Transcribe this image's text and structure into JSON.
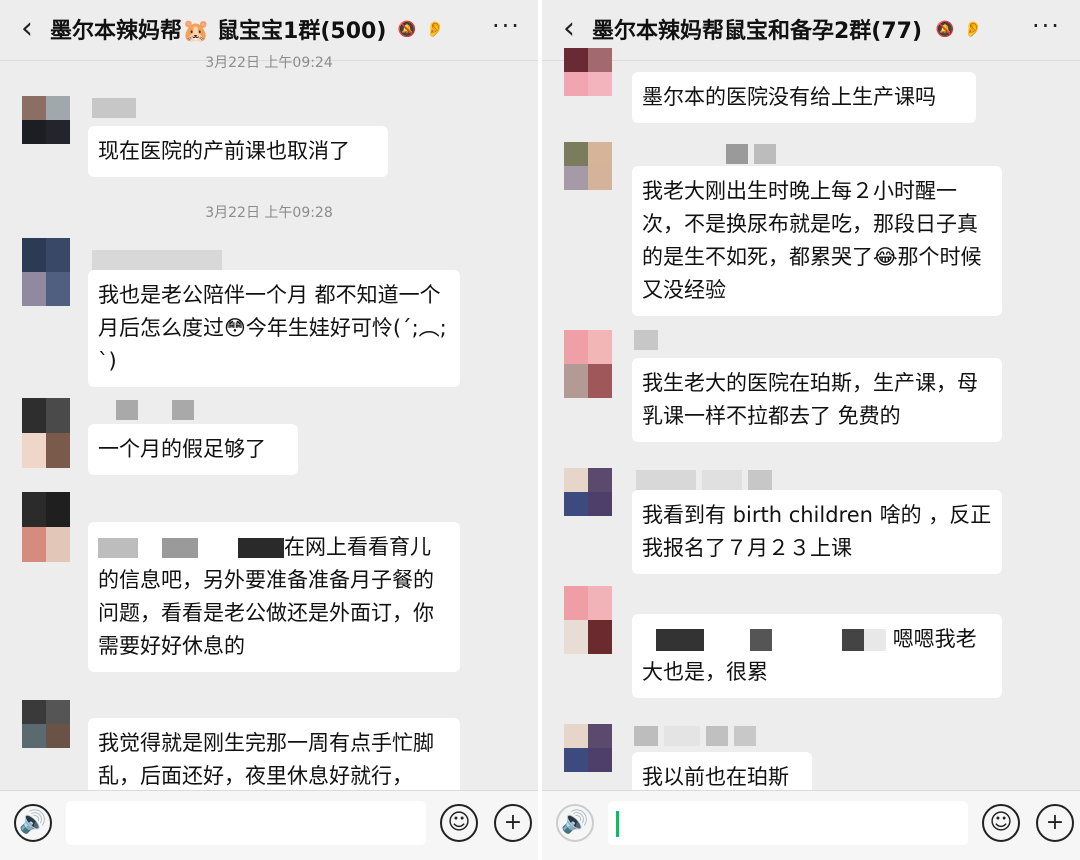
{
  "left": {
    "title": "墨尔本辣妈帮🐹 鼠宝宝1群(500)",
    "back": "‹",
    "mute_icon": "🔕",
    "ear_icon": "👂",
    "more": "···",
    "timestamps": [
      "3月22日 上午09:24",
      "3月22日 上午09:28"
    ],
    "messages": [
      "现在医院的产前课也取消了",
      "我也是老公陪伴一个月 都不知道一个月后怎么度过😳今年生娃好可怜(´;︵;`)",
      "一个月的假足够了",
      "在网上看看育儿的信息吧，另外要准备准备月子餐的问题，看看是老公做还是外面订，你需要好好休息的",
      "我觉得就是刚生完那一周有点手忙脚乱，后面还好，夜里休息好就行，"
    ]
  },
  "right": {
    "title": "墨尔本辣妈帮鼠宝和备孕2群(77)",
    "back": "‹",
    "mute_icon": "🔕",
    "ear_icon": "👂",
    "more": "···",
    "messages": [
      "墨尔本的医院没有给上生产课吗",
      "我老大刚出生时晚上每２小时醒一次，不是换尿布就是吃，那段日子真的是生不如死，都累哭了😂那个时候又没经验",
      "我生老大的医院在珀斯，生产课，母乳课一样不拉都去了 免费的",
      "我看到有 birth children 啥的 ，反正我报名了７月２３上课",
      "嗯嗯我老大也是，很累",
      "我以前也在珀斯"
    ]
  },
  "input_bar": {
    "voice_icon": "🔊",
    "emoji_icon": "☺",
    "plus_icon": "+"
  }
}
